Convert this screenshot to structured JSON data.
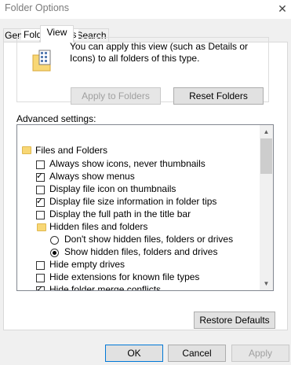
{
  "window": {
    "title": "Folder Options",
    "close_glyph": "✕"
  },
  "tabs": [
    {
      "label": "General",
      "active": false
    },
    {
      "label": "View",
      "active": true
    },
    {
      "label": "Search",
      "active": false
    }
  ],
  "folder_views": {
    "legend": "Folder views",
    "description": "You can apply this view (such as Details or Icons) to all folders of this type.",
    "icon": "folder-view-icon",
    "apply_button": "Apply to Folders",
    "reset_button": "Reset Folders"
  },
  "advanced": {
    "label": "Advanced settings:",
    "items": [
      {
        "type": "folder",
        "label": "Files and Folders",
        "level": 0
      },
      {
        "type": "checkbox",
        "label": "Always show icons, never thumbnails",
        "checked": false,
        "level": 1
      },
      {
        "type": "checkbox",
        "label": "Always show menus",
        "checked": true,
        "level": 1
      },
      {
        "type": "checkbox",
        "label": "Display file icon on thumbnails",
        "checked": false,
        "level": 1
      },
      {
        "type": "checkbox",
        "label": "Display file size information in folder tips",
        "checked": true,
        "level": 1
      },
      {
        "type": "checkbox",
        "label": "Display the full path in the title bar",
        "checked": false,
        "level": 1
      },
      {
        "type": "folder",
        "label": "Hidden files and folders",
        "level": 1
      },
      {
        "type": "radio",
        "label": "Don't show hidden files, folders or drives",
        "checked": false,
        "level": 2
      },
      {
        "type": "radio",
        "label": "Show hidden files, folders and drives",
        "checked": true,
        "level": 2
      },
      {
        "type": "checkbox",
        "label": "Hide empty drives",
        "checked": false,
        "level": 1
      },
      {
        "type": "checkbox",
        "label": "Hide extensions for known file types",
        "checked": false,
        "level": 1
      },
      {
        "type": "checkbox",
        "label": "Hide folder merge conflicts",
        "checked": true,
        "level": 1
      }
    ],
    "scroll_up": "▲",
    "scroll_down": "▼",
    "restore_button": "Restore Defaults"
  },
  "footer": {
    "ok": "OK",
    "cancel": "Cancel",
    "apply": "Apply"
  },
  "check_glyph": "✓",
  "colors": {
    "accent": "#0078d7",
    "folder": "#f8d775"
  }
}
